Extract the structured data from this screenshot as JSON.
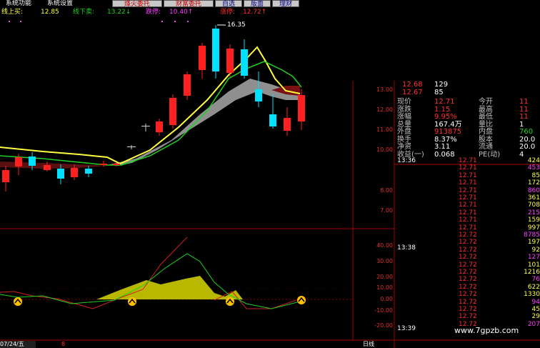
{
  "menu": {
    "system_functions": "系统功能",
    "system_settings": "系统设置"
  },
  "toolbar": {
    "btn1": "烽火委托",
    "btn2": "财富委托",
    "btn3": "自选",
    "btn4": "版面",
    "btn5": "理财"
  },
  "info": {
    "upper_label": "线上买:",
    "upper_value": "12.85",
    "lower_label": "线下卖:",
    "lower_value": "13.22↓",
    "limit_down_label": "跌停:",
    "limit_down_value": "10.40↑",
    "limit_up_label": "涨停:",
    "limit_up_value": "12.72↑"
  },
  "chart": {
    "high_label": "16.35",
    "price_ticks": [
      "13.00",
      "12.00",
      "11.00",
      "10.00",
      "8.00",
      "7.00"
    ],
    "indicator_ticks": [
      "40.00",
      "30.00",
      "20.00",
      "10.00",
      "0.00",
      "-10.00",
      "-20.00"
    ],
    "period_label": "日线",
    "date_label": "07/24/五",
    "date_marker": "8"
  },
  "quote": {
    "ask1": {
      "price": "12.68",
      "vol": "129"
    },
    "ask2": {
      "price": "12.67",
      "vol": "85"
    },
    "rows": [
      {
        "l": "现价",
        "lv": "12.71",
        "r": "今开",
        "rv": "11"
      },
      {
        "l": "涨跌",
        "lv": "1.15",
        "r": "最高",
        "rv": "11"
      },
      {
        "l": "涨幅",
        "lv": "9.95%",
        "r": "最低",
        "rv": "11"
      },
      {
        "l": "总量",
        "lv": "167.4万",
        "r": "量比",
        "rv": "1"
      },
      {
        "l": "外盘",
        "lv": "913875",
        "r": "内盘",
        "rv": "760"
      },
      {
        "l": "换手",
        "lv": "8.37%",
        "r": "股本",
        "rv": "20.0"
      },
      {
        "l": "净资",
        "lv": "3.11",
        "r": "流通",
        "rv": "20.0"
      },
      {
        "l": "收益(一)",
        "lv": "0.068",
        "r": "PE(动)",
        "rv": "4"
      }
    ]
  },
  "ticks": {
    "time1": "13:36",
    "time2": "13:38",
    "time3": "13:39",
    "rows": [
      {
        "p": "12.71",
        "v": "424"
      },
      {
        "p": "12.71",
        "v": "453"
      },
      {
        "p": "12.71",
        "v": "85"
      },
      {
        "p": "12.71",
        "v": "172"
      },
      {
        "p": "12.71",
        "v": "860"
      },
      {
        "p": "12.71",
        "v": "361"
      },
      {
        "p": "12.71",
        "v": "708"
      },
      {
        "p": "12.71",
        "v": "215"
      },
      {
        "p": "12.71",
        "v": "159"
      },
      {
        "p": "12.71",
        "v": "997"
      },
      {
        "p": "12.72",
        "v": "8785"
      },
      {
        "p": "12.72",
        "v": "197"
      },
      {
        "p": "12.72",
        "v": "92"
      },
      {
        "p": "12.72",
        "v": "127"
      },
      {
        "p": "12.72",
        "v": "101"
      },
      {
        "p": "12.72",
        "v": "1216"
      },
      {
        "p": "12.72",
        "v": "76"
      },
      {
        "p": "12.72",
        "v": "622"
      },
      {
        "p": "12.72",
        "v": "1330"
      },
      {
        "p": "12.72",
        "v": "94"
      },
      {
        "p": "12.72",
        "v": "45"
      },
      {
        "p": "12.72",
        "v": "29"
      },
      {
        "p": "12.72",
        "v": "207"
      }
    ]
  },
  "watermark": "www.7gpzb.com",
  "colors": {
    "up": "#ff2020",
    "down": "#00e0ff",
    "ma_yellow": "#ffff40",
    "ma_green": "#20d020"
  }
}
